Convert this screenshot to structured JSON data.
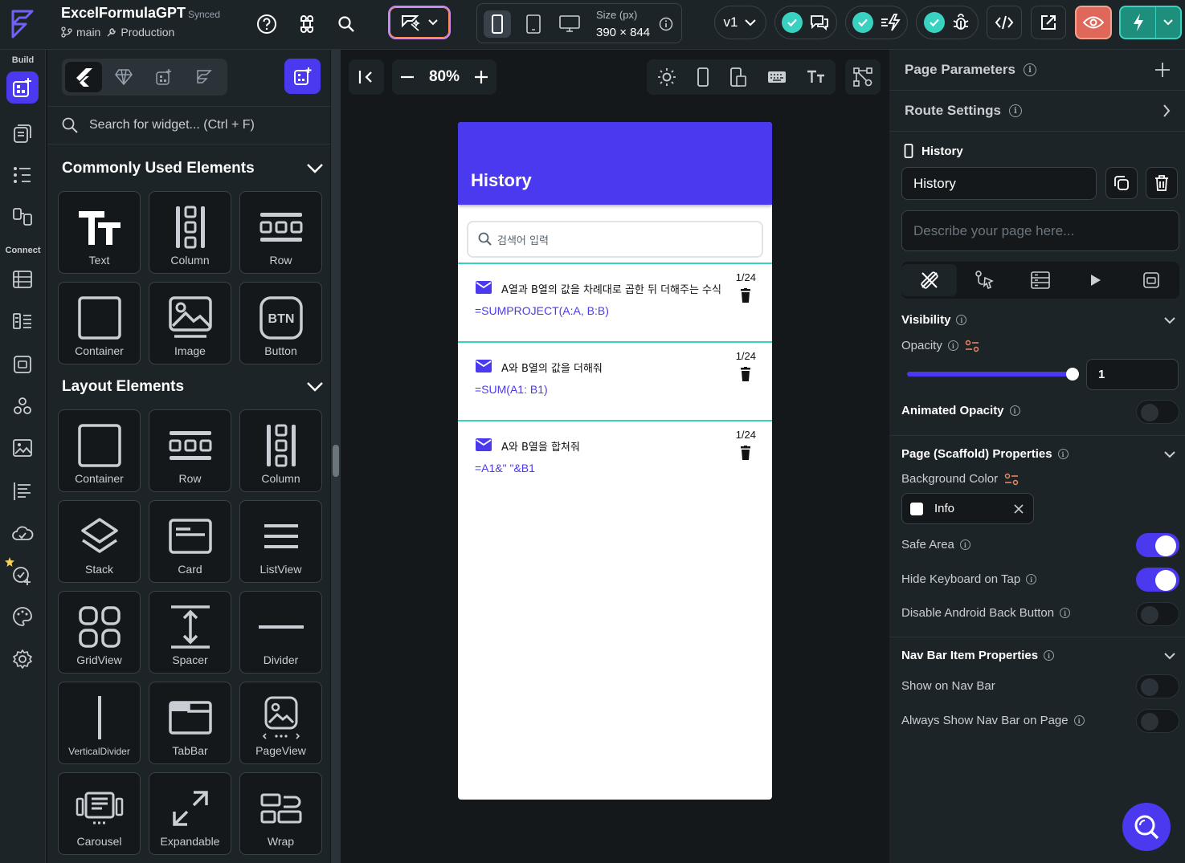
{
  "app": {
    "project_name": "ExcelFormulaGPT",
    "sync_status": "Synced",
    "branch": "main",
    "environment": "Production",
    "brand_color": "#4b39ef"
  },
  "toolbar": {
    "icons": [
      "help-icon",
      "command-icon",
      "search-icon"
    ],
    "size_label": "Size (px)",
    "size_value": "390 × 844",
    "version": "v1",
    "device_modes": [
      "phone",
      "tablet",
      "desktop"
    ]
  },
  "rail": {
    "build_label": "Build",
    "connect_label": "Connect"
  },
  "widgets": {
    "search_placeholder": "Search for widget... (Ctrl + F)",
    "common_title": "Commonly Used Elements",
    "common": [
      {
        "label": "Text",
        "icon": "text-icon"
      },
      {
        "label": "Column",
        "icon": "column-icon"
      },
      {
        "label": "Row",
        "icon": "row-icon"
      },
      {
        "label": "Container",
        "icon": "container-icon"
      },
      {
        "label": "Image",
        "icon": "image-icon"
      },
      {
        "label": "Button",
        "icon": "button-icon"
      }
    ],
    "layout_title": "Layout Elements",
    "layout": [
      {
        "label": "Container",
        "icon": "container-icon"
      },
      {
        "label": "Row",
        "icon": "row-icon"
      },
      {
        "label": "Column",
        "icon": "column-icon"
      },
      {
        "label": "Stack",
        "icon": "stack-icon"
      },
      {
        "label": "Card",
        "icon": "card-icon"
      },
      {
        "label": "ListView",
        "icon": "listview-icon"
      },
      {
        "label": "GridView",
        "icon": "gridview-icon"
      },
      {
        "label": "Spacer",
        "icon": "spacer-icon"
      },
      {
        "label": "Divider",
        "icon": "divider-icon"
      },
      {
        "label": "VerticalDivider",
        "icon": "vertical-divider-icon"
      },
      {
        "label": "TabBar",
        "icon": "tabbar-icon"
      },
      {
        "label": "PageView",
        "icon": "pageview-icon"
      },
      {
        "label": "Carousel",
        "icon": "carousel-icon"
      },
      {
        "label": "Expandable",
        "icon": "expandable-icon"
      },
      {
        "label": "Wrap",
        "icon": "wrap-icon"
      }
    ]
  },
  "canvas": {
    "zoom": "80%",
    "phone": {
      "appbar_title": "History",
      "search_placeholder": "검색어 입력",
      "items": [
        {
          "question": "A열과 B열의 값을 차례대로 곱한 뒤 더해주는 수식",
          "formula": "=SUMPROJECT(A:A, B:B)",
          "date": "1/24"
        },
        {
          "question": "A와 B열의 값을 더해줘",
          "formula": "=SUM(A1: B1)",
          "date": "1/24"
        },
        {
          "question": "A와 B열을 합쳐줘",
          "formula": "=A1&\" \"&B1",
          "date": "1/24"
        }
      ]
    }
  },
  "properties": {
    "page_parameters": "Page Parameters",
    "route_settings": "Route Settings",
    "page_label": "History",
    "page_name": "History",
    "description_placeholder": "Describe your page here...",
    "visibility": "Visibility",
    "opacity_label": "Opacity",
    "opacity_value": "1",
    "opacity_fraction": 1.0,
    "animated_opacity": "Animated Opacity",
    "scaffold_title": "Page (Scaffold) Properties",
    "background_color_label": "Background Color",
    "background_color_value": "Info",
    "safe_area": "Safe Area",
    "safe_area_on": true,
    "hide_keyboard": "Hide Keyboard on Tap",
    "hide_keyboard_on": true,
    "disable_back": "Disable Android Back Button",
    "disable_back_on": false,
    "nav_title": "Nav Bar Item Properties",
    "show_nav": "Show on Nav Bar",
    "show_nav_on": false,
    "always_nav": "Always Show Nav Bar on Page",
    "always_nav_on": false
  }
}
